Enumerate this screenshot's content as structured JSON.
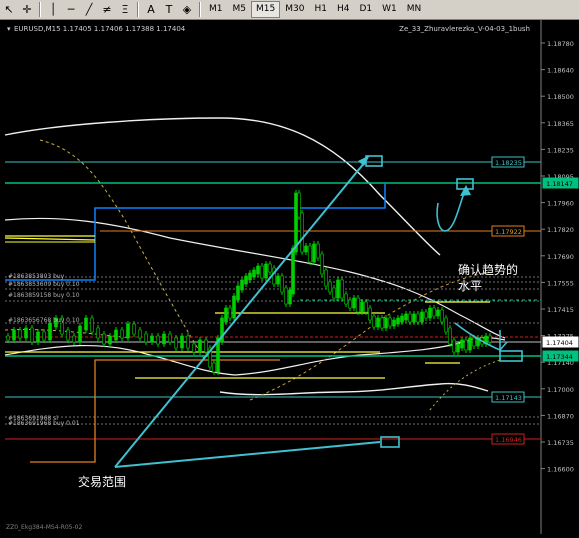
{
  "toolbar": {
    "timeframes": [
      "M1",
      "M5",
      "M15",
      "M30",
      "H1",
      "H4",
      "D1",
      "W1",
      "MN"
    ],
    "active_timeframe": "M15",
    "icons": [
      "cursor-icon",
      "crosshair-icon",
      "vertical-line-icon",
      "horizontal-line-icon",
      "trendline-icon",
      "channel-icon",
      "fibonacci-icon",
      "text-icon",
      "label-icon",
      "shapes-icon"
    ]
  },
  "chart": {
    "symbol_header": "EURUSD,M15  1.17405 1.17406 1.17388 1.17404",
    "indicator_label": "Ze_33_Zhuravlerezka_V-04-03_1bush",
    "bottom_label": "ZZ0_Ekg384-MS4-R05-02",
    "price_axis": [
      "1.18780",
      "1.18640",
      "1.18500",
      "1.18365",
      "1.18235",
      "1.18095",
      "1.17960",
      "1.17820",
      "1.17690",
      "1.17555",
      "1.17415",
      "1.17275",
      "1.17140",
      "1.17000",
      "1.16870",
      "1.16735",
      "1.16600"
    ],
    "price_tags": [
      {
        "text": "1.18235",
        "color": "#40c0c0",
        "fill": "#000000",
        "fg": "#40c0c0"
      },
      {
        "text": "1.18147",
        "color": "#00c080",
        "fill": "#00c080",
        "fg": "#000000"
      },
      {
        "text": "1.17922",
        "color": "#e08020",
        "fill": "#000000",
        "fg": "#e0a020"
      },
      {
        "text": "1.17404",
        "color": "#ffffff",
        "fill": "#ffffff",
        "fg": "#000000"
      },
      {
        "text": "1.17344",
        "color": "#00c080",
        "fill": "#00c080",
        "fg": "#000000"
      },
      {
        "text": "1.17143",
        "color": "#40c0c0",
        "fill": "#000000",
        "fg": "#40c0c0"
      },
      {
        "text": "1.16946",
        "color": "#d02020",
        "fill": "#000000",
        "fg": "#d02020"
      }
    ],
    "order_labels": [
      "#1863853803 buy",
      "#1863853609 buy 0.10",
      "#1863859158 buy 0.10",
      "#1863656768 buy 0.10",
      "#1863691968 sl",
      "#1863691968 buy 0.01"
    ],
    "annotations": {
      "confirm_trend": "确认趋势的",
      "level": "水平",
      "trade_range": "交易范围"
    },
    "colors": {
      "accent_cyan": "#40c0d0",
      "candle_green": "#00d000",
      "envelope_white": "#f0f0f0",
      "level_yellow": "#ffff40",
      "level_orange": "#e08020",
      "level_red": "#d02020",
      "level_green": "#00c080",
      "blue_step": "#1080ff"
    }
  }
}
